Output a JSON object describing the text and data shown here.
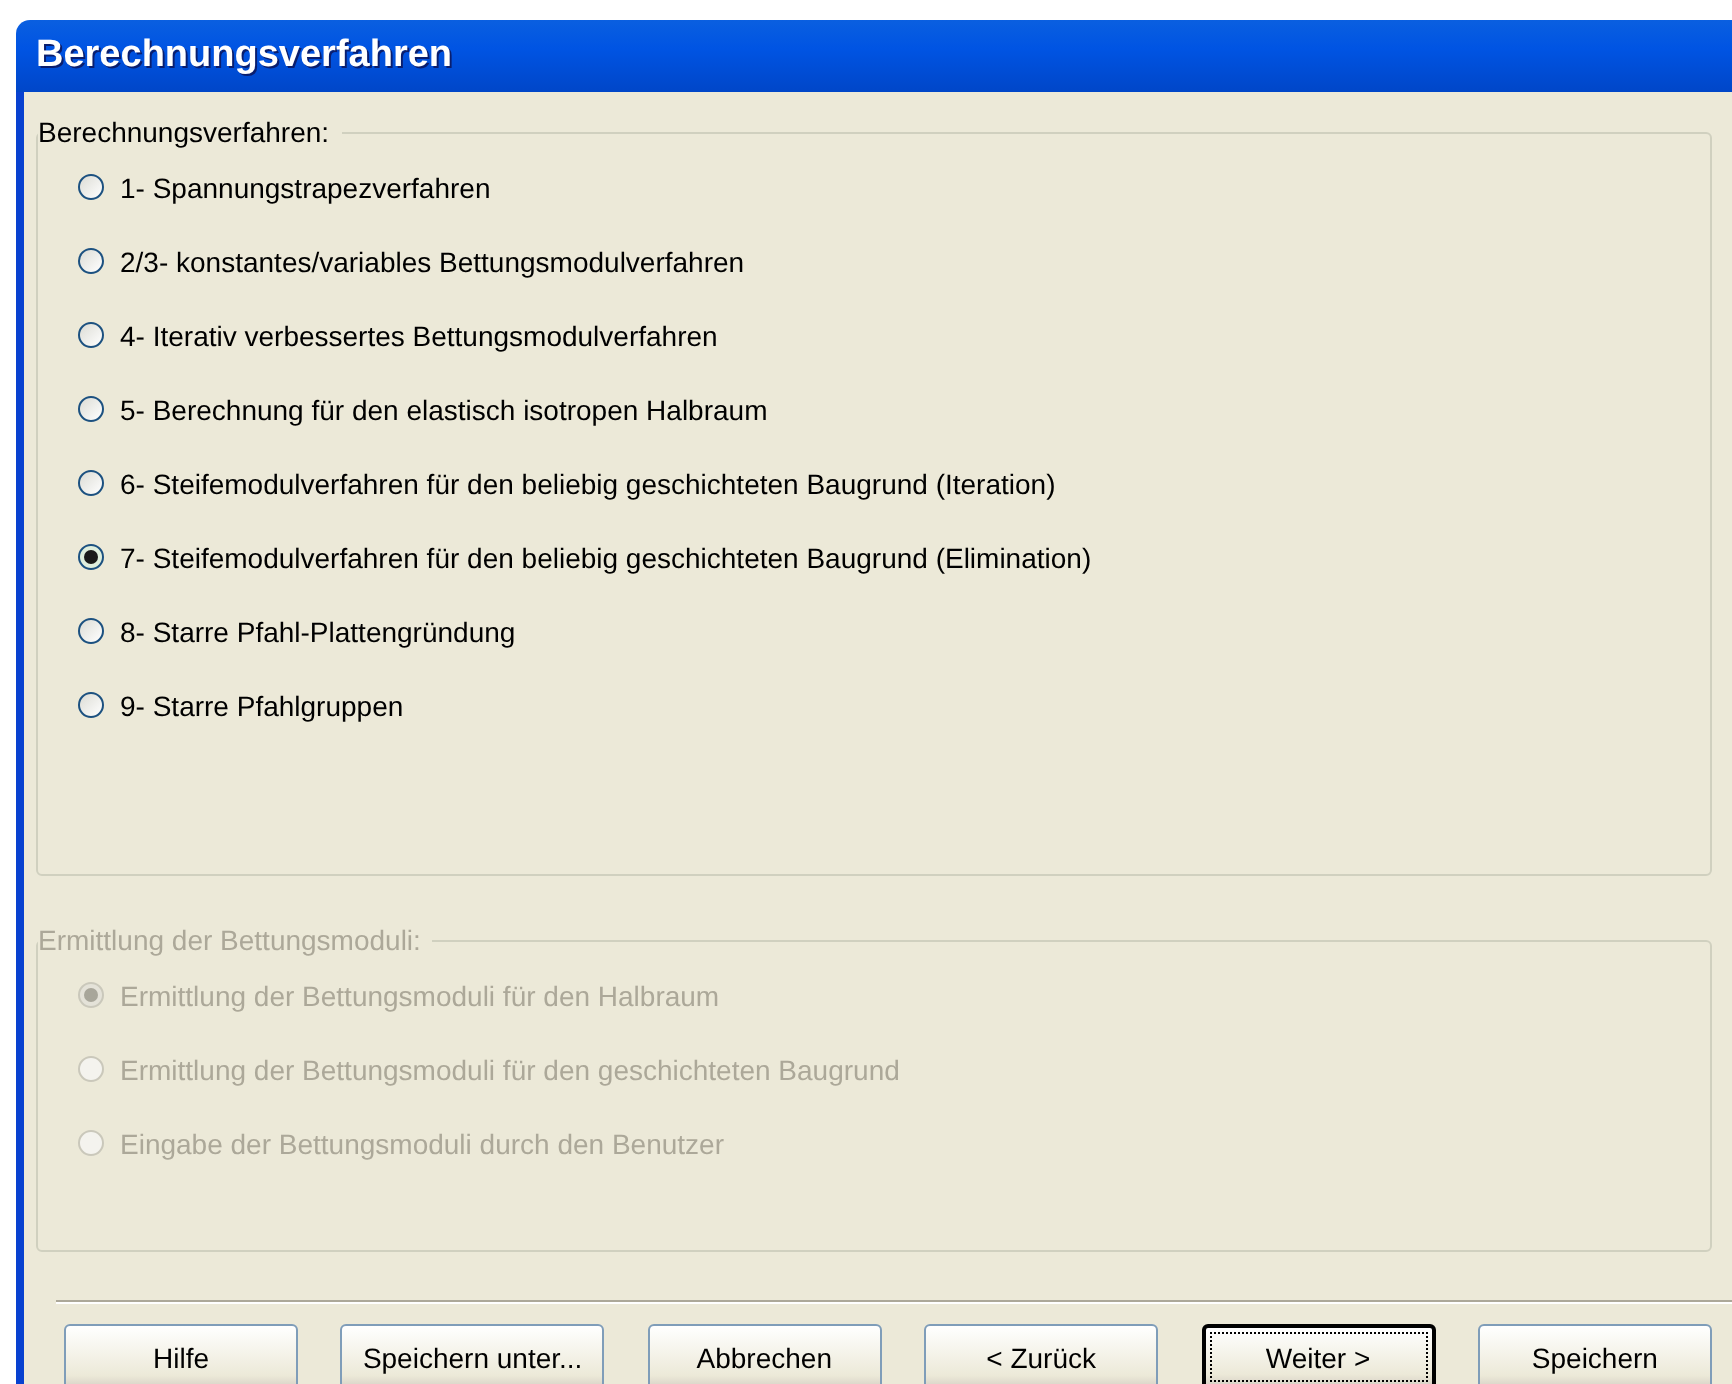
{
  "window": {
    "title": "Berechnungsverfahren"
  },
  "groups": [
    {
      "label": "Berechnungsverfahren:",
      "disabled": false,
      "options": [
        {
          "label": "1- Spannungstrapezverfahren",
          "selected": false
        },
        {
          "label": "2/3- konstantes/variables Bettungsmodulverfahren",
          "selected": false
        },
        {
          "label": "4- Iterativ verbessertes Bettungsmodulverfahren",
          "selected": false
        },
        {
          "label": "5- Berechnung für den elastisch isotropen Halbraum",
          "selected": false
        },
        {
          "label": "6- Steifemodulverfahren für den beliebig geschichteten Baugrund (Iteration)",
          "selected": false
        },
        {
          "label": "7- Steifemodulverfahren für den beliebig geschichteten Baugrund (Elimination)",
          "selected": true
        },
        {
          "label": "8- Starre Pfahl-Plattengründung",
          "selected": false
        },
        {
          "label": "9- Starre Pfahlgruppen",
          "selected": false
        }
      ]
    },
    {
      "label": "Ermittlung der Bettungsmoduli:",
      "disabled": true,
      "options": [
        {
          "label": "Ermittlung der Bettungsmoduli für den Halbraum",
          "selected": true
        },
        {
          "label": "Ermittlung der Bettungsmoduli für den geschichteten Baugrund",
          "selected": false
        },
        {
          "label": "Eingabe der Bettungsmoduli durch den Benutzer",
          "selected": false
        }
      ]
    }
  ],
  "buttons": [
    {
      "label": "Hilfe",
      "default": false
    },
    {
      "label": "Speichern unter...",
      "default": false
    },
    {
      "label": "Abbrechen",
      "default": false
    },
    {
      "label": "< Zurück",
      "default": false
    },
    {
      "label": "Weiter >",
      "default": true
    },
    {
      "label": "Speichern",
      "default": false
    }
  ]
}
